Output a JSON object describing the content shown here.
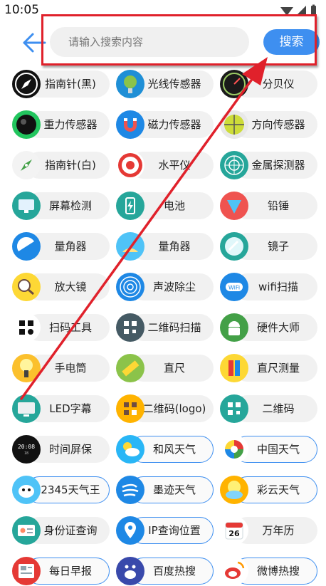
{
  "status": {
    "time": "10:05"
  },
  "search": {
    "placeholder": "请输入搜索内容",
    "button_label": "搜索"
  },
  "tools": [
    {
      "label": "指南针(黑)",
      "icon": "compass-black-icon",
      "bg": "#111111",
      "outlined": false
    },
    {
      "label": "光线传感器",
      "icon": "light-sensor-icon",
      "bg": "#1f8fd6",
      "outlined": false
    },
    {
      "label": "分贝仪",
      "icon": "decibel-meter-icon",
      "bg": "#1a1a1a",
      "outlined": false
    },
    {
      "label": "重力传感器",
      "icon": "gravity-sensor-icon",
      "bg": "#22c55e",
      "outlined": false
    },
    {
      "label": "磁力传感器",
      "icon": "magnet-icon",
      "bg": "#1e88e5",
      "outlined": false
    },
    {
      "label": "方向传感器",
      "icon": "level-bubble-icon",
      "bg": "#e8e8e8",
      "outlined": false
    },
    {
      "label": "指南针(白)",
      "icon": "compass-white-icon",
      "bg": "#f3f3f3",
      "outlined": false
    },
    {
      "label": "水平仪",
      "icon": "target-level-icon",
      "bg": "#ffffff",
      "outlined": false
    },
    {
      "label": "金属探测器",
      "icon": "radar-icon",
      "bg": "#26a69a",
      "outlined": false
    },
    {
      "label": "屏幕检测",
      "icon": "monitor-icon",
      "bg": "#26a69a",
      "outlined": false
    },
    {
      "label": "电池",
      "icon": "battery-icon",
      "bg": "#26a69a",
      "outlined": false
    },
    {
      "label": "铅锤",
      "icon": "plumb-bob-icon",
      "bg": "#ef5350",
      "outlined": false
    },
    {
      "label": "量角器",
      "icon": "protractor-icon",
      "bg": "#1e88e5",
      "outlined": false
    },
    {
      "label": "量角器",
      "icon": "protractor-ruler-icon",
      "bg": "#4fc3f7",
      "outlined": false
    },
    {
      "label": "镜子",
      "icon": "mirror-icon",
      "bg": "#26a69a",
      "outlined": false
    },
    {
      "label": "放大镜",
      "icon": "magnifier-icon",
      "bg": "#fdd835",
      "outlined": false
    },
    {
      "label": "声波除尘",
      "icon": "sound-wave-icon",
      "bg": "#1e88e5",
      "outlined": false
    },
    {
      "label": "wifi扫描",
      "icon": "wifi-icon",
      "bg": "#1e88e5",
      "outlined": false
    },
    {
      "label": "扫码工具",
      "icon": "scan-icon",
      "bg": "#ffffff",
      "outlined": false
    },
    {
      "label": "二维码扫描",
      "icon": "qr-scan-icon",
      "bg": "#455a64",
      "outlined": false
    },
    {
      "label": "硬件大师",
      "icon": "android-icon",
      "bg": "#43a047",
      "outlined": false
    },
    {
      "label": "手电筒",
      "icon": "flashlight-icon",
      "bg": "#fbc02d",
      "outlined": false
    },
    {
      "label": "直尺",
      "icon": "ruler-icon",
      "bg": "#8bc34a",
      "outlined": false
    },
    {
      "label": "直尺测量",
      "icon": "ruler-measure-icon",
      "bg": "#fdd835",
      "outlined": false
    },
    {
      "label": "LED字幕",
      "icon": "led-screen-icon",
      "bg": "#26a69a",
      "outlined": false
    },
    {
      "label": "二维码(logo)",
      "icon": "qr-logo-icon",
      "bg": "#ffb300",
      "outlined": false
    },
    {
      "label": "二维码",
      "icon": "qr-code-icon",
      "bg": "#26a69a",
      "outlined": false
    },
    {
      "label": "时间屏保",
      "icon": "digital-clock-icon",
      "bg": "#111111",
      "outlined": false
    },
    {
      "label": "和风天气",
      "icon": "weather-sun-cloud-icon",
      "bg": "#29b6f6",
      "outlined": true
    },
    {
      "label": "中国天气",
      "icon": "rainbow-swirl-icon",
      "bg": "#ffffff",
      "outlined": true
    },
    {
      "label": "2345天气王",
      "icon": "bird-mascot-icon",
      "bg": "#4fc3f7",
      "outlined": true
    },
    {
      "label": "墨迹天气",
      "icon": "wind-icon",
      "bg": "#1e88e5",
      "outlined": true
    },
    {
      "label": "彩云天气",
      "icon": "sunny-cloud-icon",
      "bg": "#ffb300",
      "outlined": true
    },
    {
      "label": "身份证查询",
      "icon": "id-card-icon",
      "bg": "#26a69a",
      "outlined": false
    },
    {
      "label": "IP查询位置",
      "icon": "location-pin-icon",
      "bg": "#1e88e5",
      "outlined": true
    },
    {
      "label": "万年历",
      "icon": "calendar-icon",
      "bg": "#ffffff",
      "outlined": false
    },
    {
      "label": "每日早报",
      "icon": "newspaper-icon",
      "bg": "#e53935",
      "outlined": true
    },
    {
      "label": "百度热搜",
      "icon": "baidu-icon",
      "bg": "#3949ab",
      "outlined": true
    },
    {
      "label": "微博热搜",
      "icon": "weibo-icon",
      "bg": "#ffffff",
      "outlined": true
    }
  ],
  "calendar_day": "26",
  "accent": "#3e8ff0",
  "annotation_color": "#e0212b"
}
